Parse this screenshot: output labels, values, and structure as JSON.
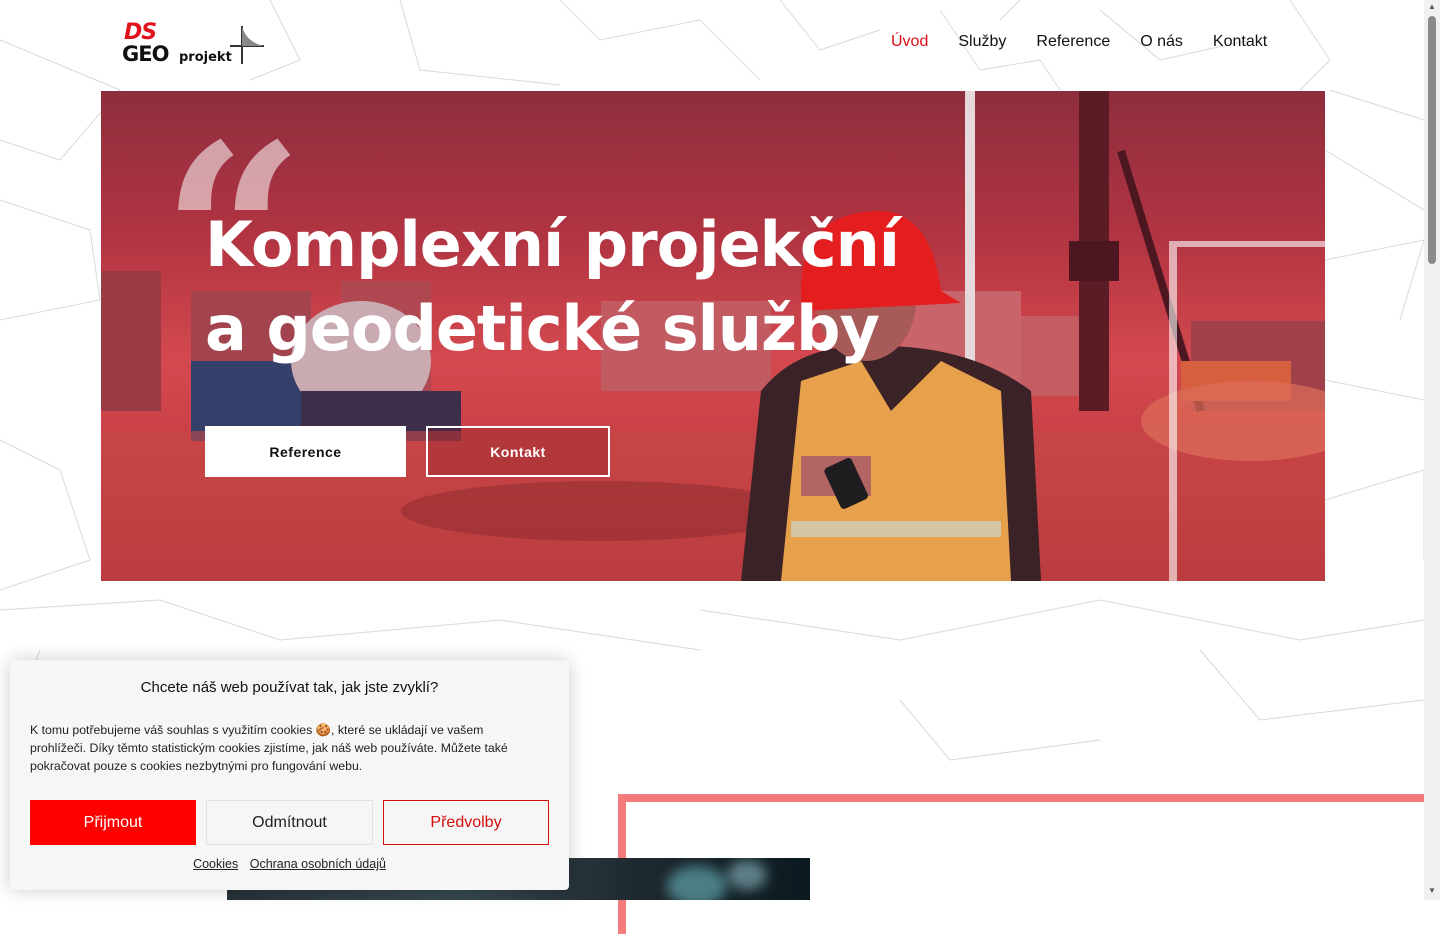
{
  "header": {
    "logo": {
      "line1": "DS",
      "line2": "GEO",
      "line3": "projekt"
    },
    "nav": [
      {
        "label": "Úvod",
        "active": true
      },
      {
        "label": "Služby",
        "active": false
      },
      {
        "label": "Reference",
        "active": false
      },
      {
        "label": "O nás",
        "active": false
      },
      {
        "label": "Kontakt",
        "active": false
      }
    ]
  },
  "hero": {
    "quote_glyph": "“",
    "headline_line1": "Komplexní projekční",
    "headline_line2": "a geodetické služby",
    "btn_reference": "Reference",
    "btn_kontakt": "Kontakt"
  },
  "cookie_banner": {
    "title": "Chcete náš web používat tak, jak jste zvyklí?",
    "text": "K tomu potřebujeme váš souhlas s využitím cookies 🍪, které se ukládají ve vašem prohlížeči. Díky těmto statistickým cookies zjistíme, jak náš web používáte. Můžete také pokračovat pouze s cookies nezbytnými pro fungování webu.",
    "accept": "Přijmout",
    "deny": "Odmítnout",
    "prefs": "Předvolby",
    "link_cookies": "Cookies",
    "link_privacy": "Ochrana osobních údajů"
  },
  "colors": {
    "accent": "#d90f17",
    "hero_overlay": "#c8404a",
    "accept_button": "#ff0000",
    "frame": "#f27b7b"
  }
}
